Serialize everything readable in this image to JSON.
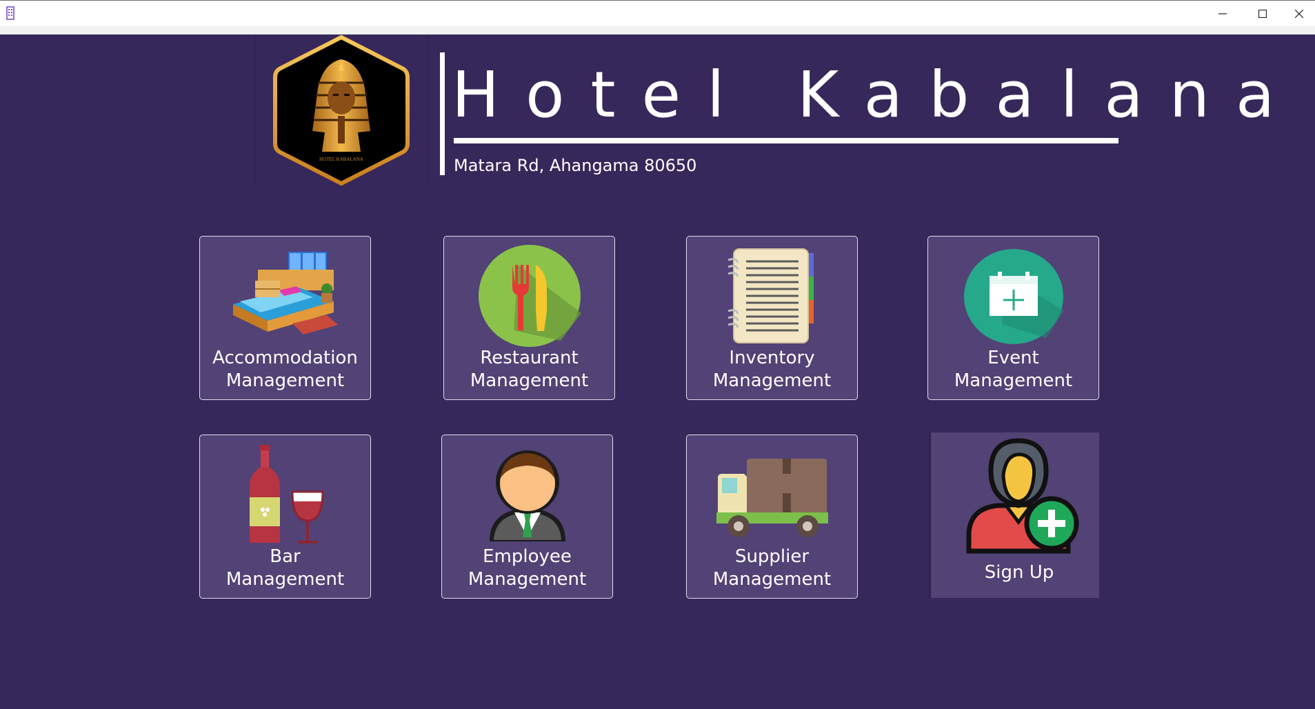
{
  "window": {
    "controls": {
      "minimize": "minimize-icon",
      "maximize": "maximize-icon",
      "close": "close-icon"
    }
  },
  "header": {
    "logo_icon": "pharaoh-hexagon-logo",
    "logo_text": "HOTEL KABALANA",
    "title": "Hotel Kabalana",
    "address": "Matara Rd, Ahangama 80650"
  },
  "tiles": [
    {
      "line1": "Accommodation",
      "line2": "Management",
      "icon": "bed-room-icon"
    },
    {
      "line1": "Restaurant",
      "line2": "Management",
      "icon": "fork-knife-icon"
    },
    {
      "line1": "Inventory",
      "line2": "Management",
      "icon": "notebook-icon"
    },
    {
      "line1": "Event",
      "line2": "Management",
      "icon": "calendar-add-icon"
    },
    {
      "line1": "Bar",
      "line2": "Management",
      "icon": "wine-icon"
    },
    {
      "line1": "Employee",
      "line2": "Management",
      "icon": "employee-icon"
    },
    {
      "line1": "Supplier",
      "line2": "Management",
      "icon": "delivery-truck-icon"
    },
    {
      "line1": "Sign Up",
      "icon": "add-user-icon"
    }
  ],
  "colors": {
    "background": "#37285b",
    "tile": "#524275",
    "text": "#ffffff",
    "logo_ring": "#e9a83a"
  }
}
